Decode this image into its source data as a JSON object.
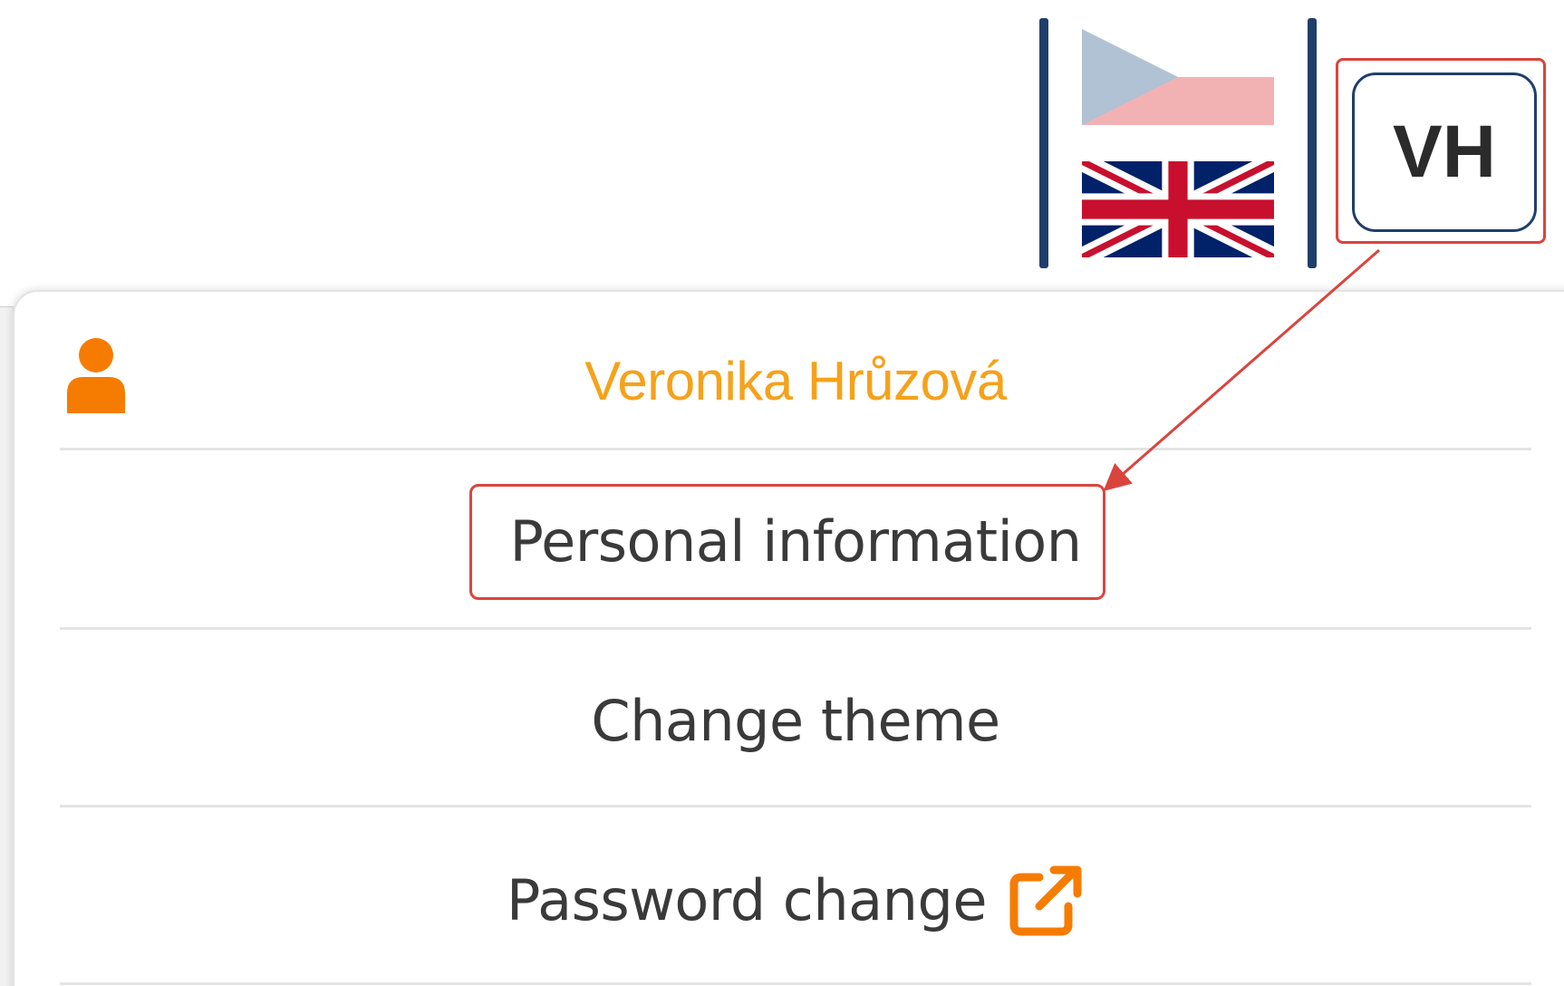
{
  "header": {
    "avatar_initials": "VH",
    "languages": [
      {
        "code": "cs",
        "icon": "czech-flag-icon",
        "active": false
      },
      {
        "code": "en",
        "icon": "uk-flag-icon",
        "active": true
      }
    ]
  },
  "user_menu": {
    "user_name": "Veronika Hrůzová",
    "user_icon": "user-icon",
    "items": [
      {
        "label": "Personal information",
        "highlighted": true
      },
      {
        "label": "Change theme"
      },
      {
        "label": "Password change",
        "icon": "external-link-icon"
      }
    ]
  },
  "colors": {
    "accent_orange": "#f5a21b",
    "icon_orange": "#f57c00",
    "navy": "#1f3f6b",
    "annotation_red": "#d9453d"
  }
}
